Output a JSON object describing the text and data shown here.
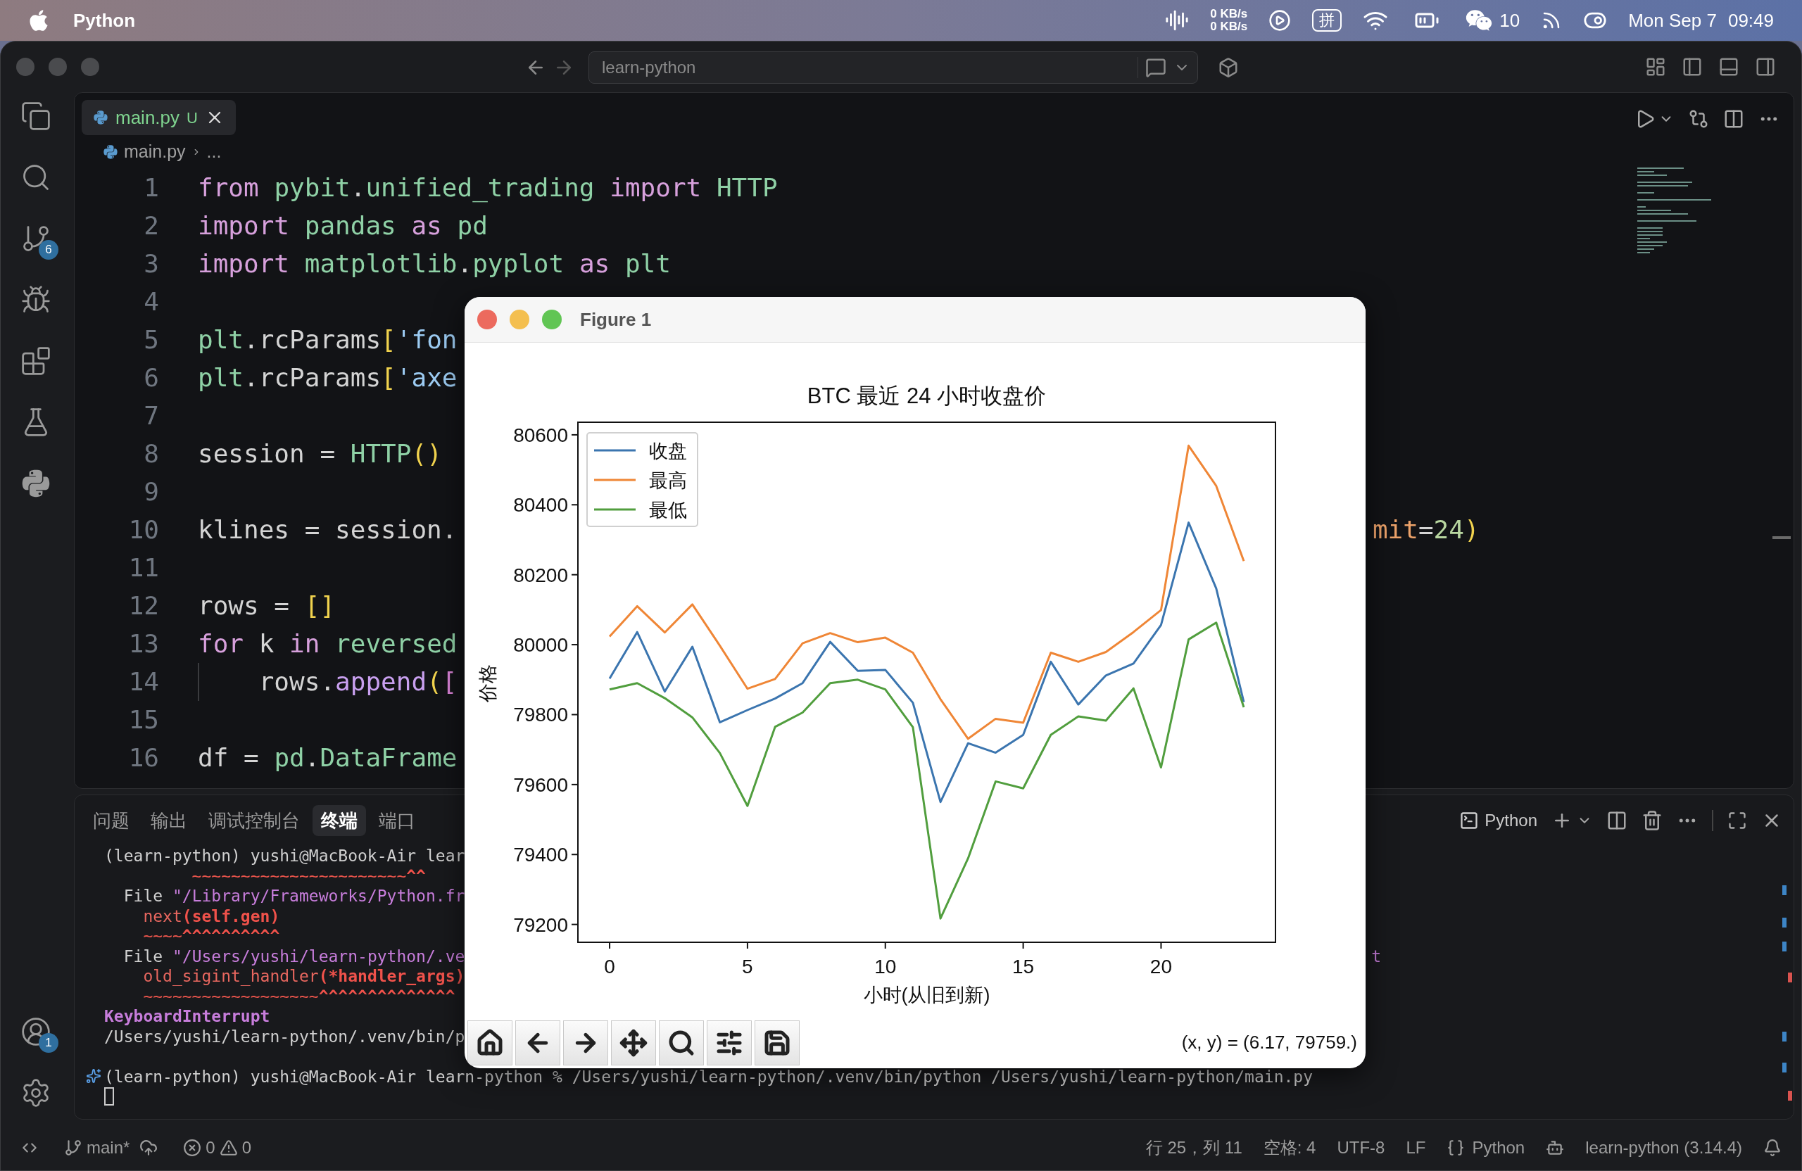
{
  "menu_bar": {
    "app_name": "Python",
    "network": [
      "0 KB/s",
      "0 KB/s"
    ],
    "input_method": "拼",
    "chat_count": "10",
    "date": "Mon Sep 7",
    "time": "09:49"
  },
  "title_bar": {
    "search": "learn-python"
  },
  "activity_bar": {
    "source_control_badge": "6",
    "accounts_badge": "1"
  },
  "editor": {
    "tab": {
      "label": "main.py",
      "status": "U"
    },
    "breadcrumb": [
      "main.py",
      "..."
    ],
    "lines": [
      {
        "n": "1",
        "tokens": [
          {
            "text": "from",
            "kind": "kw"
          },
          {
            "text": " pybit",
            "kind": "mod"
          },
          {
            "text": ".",
            "kind": "p"
          },
          {
            "text": "unified_trading",
            "kind": "mod"
          },
          {
            "text": " import",
            "kind": "kw"
          },
          {
            "text": " HTTP",
            "kind": "mod"
          }
        ]
      },
      {
        "n": "2",
        "tokens": [
          {
            "text": "import",
            "kind": "kw"
          },
          {
            "text": " pandas ",
            "kind": "mod"
          },
          {
            "text": "as",
            "kind": "kw"
          },
          {
            "text": " pd",
            "kind": "mod"
          }
        ]
      },
      {
        "n": "3",
        "tokens": [
          {
            "text": "import",
            "kind": "kw"
          },
          {
            "text": " matplotlib",
            "kind": "mod"
          },
          {
            "text": ".",
            "kind": "p"
          },
          {
            "text": "pyplot ",
            "kind": "mod"
          },
          {
            "text": "as",
            "kind": "kw"
          },
          {
            "text": " plt",
            "kind": "mod"
          }
        ]
      },
      {
        "n": "4"
      },
      {
        "n": "5",
        "tokens": [
          {
            "text": "plt",
            "kind": "mod"
          },
          {
            "text": ".rcParams",
            "kind": "p"
          },
          {
            "text": "[",
            "kind": "br"
          },
          {
            "text": "'fon",
            "kind": "str"
          }
        ]
      },
      {
        "n": "6",
        "tokens": [
          {
            "text": "plt",
            "kind": "mod"
          },
          {
            "text": ".rcParams",
            "kind": "p"
          },
          {
            "text": "[",
            "kind": "br"
          },
          {
            "text": "'axe",
            "kind": "str"
          }
        ]
      },
      {
        "n": "7"
      },
      {
        "n": "8",
        "tokens": [
          {
            "text": "session = ",
            "kind": "p"
          },
          {
            "text": "HTTP",
            "kind": "mod"
          },
          {
            "text": "()",
            "kind": "br"
          }
        ]
      },
      {
        "n": "9"
      },
      {
        "n": "10",
        "tokens": [
          {
            "text": "klines = session.",
            "kind": "p"
          }
        ],
        "tail": [
          {
            "text": "mit",
            "kind": "param"
          },
          {
            "text": "=",
            "kind": "p"
          },
          {
            "text": "24",
            "kind": "num"
          },
          {
            "text": ")",
            "kind": "br"
          }
        ]
      },
      {
        "n": "11"
      },
      {
        "n": "12",
        "tokens": [
          {
            "text": "rows = ",
            "kind": "p"
          },
          {
            "text": "[]",
            "kind": "br"
          }
        ]
      },
      {
        "n": "13",
        "tokens": [
          {
            "text": "for",
            "kind": "kw"
          },
          {
            "text": " k ",
            "kind": "p"
          },
          {
            "text": "in",
            "kind": "kw"
          },
          {
            "text": " reversed",
            "kind": "mod"
          }
        ]
      },
      {
        "n": "14",
        "indent_guide": true,
        "tokens": [
          {
            "text": "    rows.",
            "kind": "p"
          },
          {
            "text": "append",
            "kind": "fn"
          },
          {
            "text": "(",
            "kind": "br"
          },
          {
            "text": "[",
            "kind": "br2"
          }
        ]
      },
      {
        "n": "15"
      },
      {
        "n": "16",
        "tokens": [
          {
            "text": "df = ",
            "kind": "p"
          },
          {
            "text": "pd",
            "kind": "mod"
          },
          {
            "text": ".",
            "kind": "p"
          },
          {
            "text": "DataFrame",
            "kind": "mod"
          }
        ]
      }
    ]
  },
  "panel": {
    "tabs": [
      {
        "label": "问题",
        "selected": false
      },
      {
        "label": "输出",
        "selected": false
      },
      {
        "label": "调试控制台",
        "selected": false
      },
      {
        "label": "终端",
        "selected": true
      },
      {
        "label": "端口",
        "selected": false
      }
    ],
    "terminal_name": "Python",
    "terminal_lines": [
      {
        "kind": "text",
        "tokens": [
          {
            "text": "(learn-python) yushi@MacBook-Air lear",
            "kind": "p"
          }
        ]
      },
      {
        "kind": "text",
        "tokens": [
          {
            "text": "         ~~~~~~~~~~~~~~~~~~~~~~",
            "kind": "caret"
          },
          {
            "text": "^^",
            "kind": "caretb"
          }
        ]
      },
      {
        "kind": "text",
        "tokens": [
          {
            "text": "  File ",
            "kind": "p"
          },
          {
            "text": "\"/Library/Frameworks/Python.fr",
            "kind": "path"
          }
        ]
      },
      {
        "kind": "text",
        "tokens": [
          {
            "text": "    next",
            "kind": "err"
          },
          {
            "text": "(self.gen)",
            "kind": "errb"
          }
        ]
      },
      {
        "kind": "text",
        "tokens": [
          {
            "text": "    ~~~~",
            "kind": "caret"
          },
          {
            "text": "^^^^^^^^^^",
            "kind": "caretb"
          }
        ]
      },
      {
        "kind": "text",
        "tokens": [
          {
            "text": "  File ",
            "kind": "p"
          },
          {
            "text": "\"/Users/yushi/learn-python/.ve",
            "kind": "path"
          }
        ],
        "tail": [
          {
            "text": "t",
            "kind": "path"
          }
        ]
      },
      {
        "kind": "text",
        "tokens": [
          {
            "text": "    old_sigint_handler",
            "kind": "err"
          },
          {
            "text": "(*handler_args)",
            "kind": "errb"
          }
        ]
      },
      {
        "kind": "text",
        "tokens": [
          {
            "text": "    ~~~~~~~~~~~~~~~~~~",
            "kind": "caret"
          },
          {
            "text": "^^^^^^^^^^^^^^",
            "kind": "caretb"
          }
        ]
      },
      {
        "kind": "text",
        "tokens": [
          {
            "text": "KeyboardInterrupt",
            "kind": "kbi"
          }
        ]
      },
      {
        "kind": "text",
        "tokens": [
          {
            "text": "/Users/yushi/learn-python/.venv/bin/p",
            "kind": "p"
          }
        ]
      },
      {
        "kind": "prompt",
        "tokens": [
          {
            "text": "(learn-python) yushi@MacBook-Air learn-python % /Users/yushi/learn-python/.venv/bin/python /Users/yushi/learn-python/main.py",
            "kind": "p"
          }
        ]
      },
      {
        "kind": "cursor"
      }
    ]
  },
  "figure": {
    "title": "Figure 1",
    "coordinates": "(x, y) = (6.17, 79759.)",
    "chart_data": {
      "type": "line",
      "title": "BTC 最近 24 小时收盘价",
      "xlabel": "小时(从旧到新)",
      "ylabel": "价格",
      "legend": "upper left",
      "x": [
        0,
        1,
        2,
        3,
        4,
        5,
        6,
        7,
        8,
        9,
        10,
        11,
        12,
        13,
        14,
        15,
        16,
        17,
        18,
        19,
        20,
        21,
        22,
        23
      ],
      "series": [
        {
          "name": "收盘",
          "color": "#3b75af",
          "values": [
            79903,
            80036,
            79866,
            79994,
            79778,
            79813,
            79846,
            79890,
            80008,
            79925,
            79928,
            79834,
            79550,
            79718,
            79691,
            79742,
            79951,
            79829,
            79912,
            79946,
            80056,
            80349,
            80161,
            79836
          ]
        },
        {
          "name": "最高",
          "color": "#ef8636",
          "values": [
            80023,
            80110,
            80035,
            80115,
            79997,
            79874,
            79902,
            80004,
            80033,
            80007,
            80020,
            79977,
            79844,
            79731,
            79788,
            79777,
            79977,
            79951,
            79979,
            80036,
            80099,
            80569,
            80454,
            80239
          ]
        },
        {
          "name": "最低",
          "color": "#519e3e",
          "values": [
            79872,
            79890,
            79847,
            79792,
            79690,
            79539,
            79765,
            79806,
            79890,
            79900,
            79872,
            79764,
            79217,
            79389,
            79609,
            79589,
            79742,
            79795,
            79783,
            79875,
            79649,
            80015,
            80063,
            79821
          ]
        }
      ],
      "xlim": [
        -1.15,
        24.15
      ],
      "ylim": [
        79149,
        80636
      ],
      "xticks": [
        0,
        5,
        10,
        15,
        20
      ],
      "yticks": [
        79200,
        79400,
        79600,
        79800,
        80000,
        80200,
        80400,
        80600
      ]
    }
  },
  "status_bar": {
    "branch": "main*",
    "errors": "0",
    "warnings": "0",
    "position": "行 25，列 11",
    "indentation": "空格: 4",
    "encoding": "UTF-8",
    "eol": "LF",
    "language": "Python",
    "interpreter": "learn-python (3.14.4)"
  }
}
